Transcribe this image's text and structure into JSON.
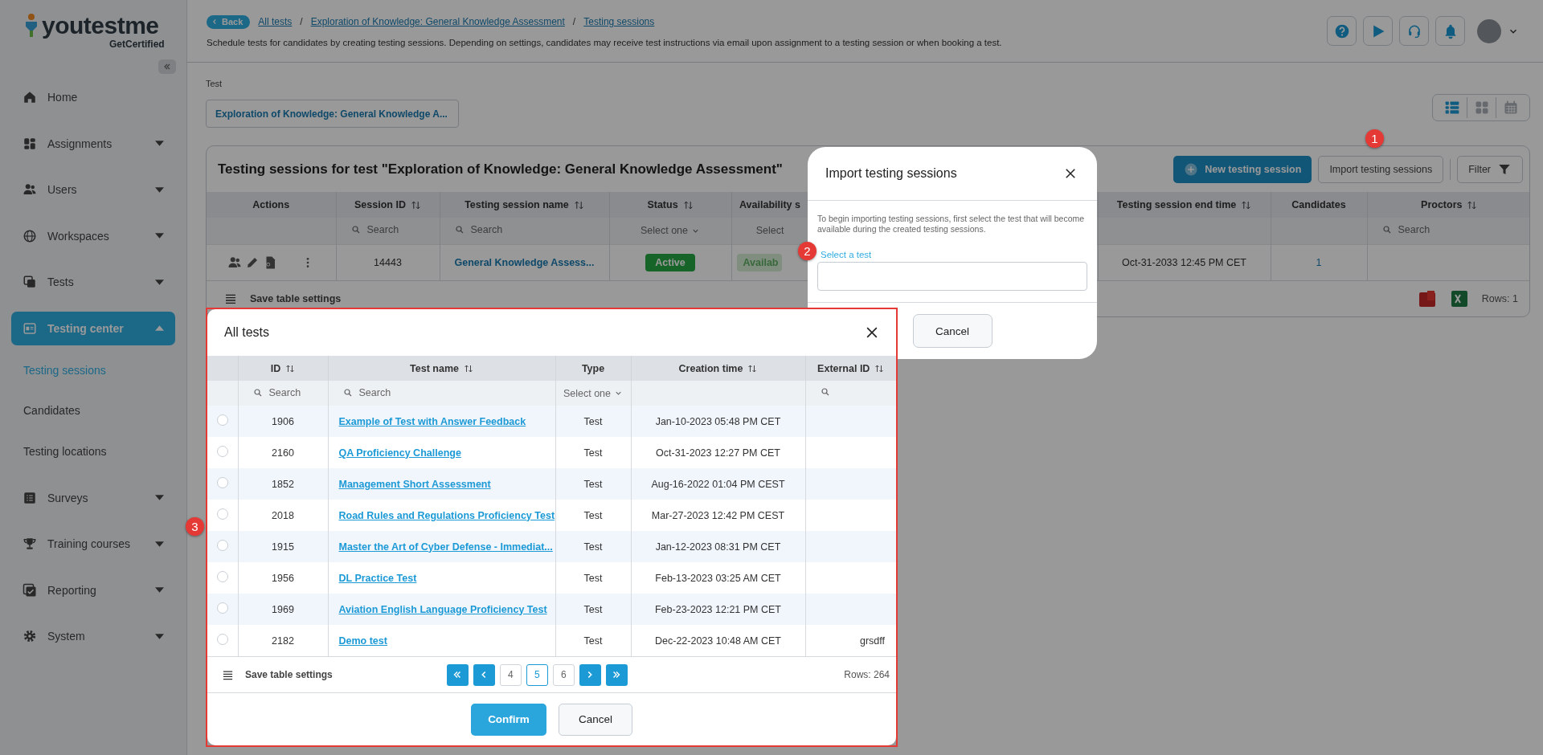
{
  "logo": {
    "wordmark": "youtestme",
    "tagline": "GetCertified"
  },
  "sidebar": {
    "items": [
      {
        "label": "Home",
        "kind": "link",
        "selected": false
      },
      {
        "label": "Assignments",
        "kind": "group",
        "expanded": false,
        "selected": false
      },
      {
        "label": "Users",
        "kind": "group",
        "expanded": false,
        "selected": false
      },
      {
        "label": "Workspaces",
        "kind": "group",
        "expanded": false,
        "selected": false
      },
      {
        "label": "Tests",
        "kind": "group",
        "expanded": false,
        "selected": false
      },
      {
        "label": "Testing center",
        "kind": "group",
        "expanded": true,
        "selected": true,
        "children": [
          {
            "label": "Testing sessions",
            "selected": true
          },
          {
            "label": "Candidates",
            "selected": false
          },
          {
            "label": "Testing locations",
            "selected": false
          }
        ]
      },
      {
        "label": "Surveys",
        "kind": "group",
        "expanded": false,
        "selected": false
      },
      {
        "label": "Training courses",
        "kind": "group",
        "expanded": false,
        "selected": false
      },
      {
        "label": "Reporting",
        "kind": "group",
        "expanded": false,
        "selected": false
      },
      {
        "label": "System",
        "kind": "group",
        "expanded": false,
        "selected": false
      }
    ]
  },
  "header": {
    "back": "Back",
    "breadcrumb": [
      "All tests",
      "Exploration of Knowledge: General Knowledge Assessment",
      "Testing sessions"
    ],
    "separator": "/",
    "description": "Schedule tests for candidates by creating testing sessions. Depending on settings, candidates may receive test instructions via email upon assignment to a testing session or when booking a test."
  },
  "test_field": {
    "label": "Test",
    "value": "Exploration of Knowledge: General Knowledge A..."
  },
  "view_modes": [
    {
      "kind": "list",
      "selected": true
    },
    {
      "kind": "grid",
      "selected": false
    },
    {
      "kind": "calendar",
      "selected": false
    }
  ],
  "sessions": {
    "title": "Testing sessions for test \"Exploration of Knowledge: General Knowledge Assessment\"",
    "new_button": "New testing session",
    "import_button": "Import testing sessions",
    "filter_button": "Filter",
    "columns": [
      {
        "label": "Actions",
        "sortable": false
      },
      {
        "label": "Session ID",
        "sortable": true,
        "filter": {
          "kind": "search",
          "placeholder": "Search"
        }
      },
      {
        "label": "Testing session name",
        "sortable": true,
        "filter": {
          "kind": "search",
          "placeholder": "Search"
        }
      },
      {
        "label": "Status",
        "sortable": true,
        "filter": {
          "kind": "select",
          "value": "Select one"
        }
      },
      {
        "label": "Availability s",
        "sortable": false,
        "filter": {
          "kind": "plain",
          "value": "Select"
        }
      },
      {
        "label": "Testing session end time",
        "sortable": true
      },
      {
        "label": "Candidates",
        "sortable": false
      },
      {
        "label": "Proctors",
        "sortable": true,
        "filter": {
          "kind": "search",
          "placeholder": "Search"
        }
      }
    ],
    "rows": [
      {
        "session_id": "14443",
        "name": "General Knowledge Assess...",
        "status": "Active",
        "availability": "Availab",
        "end_time": "Oct-31-2033 12:45 PM CET",
        "candidates": "1"
      }
    ],
    "save_settings": "Save table settings",
    "rows_count": "Rows: 1"
  },
  "import_dialog": {
    "title": "Import testing sessions",
    "description": "To begin importing testing sessions, first select the test that will become available during the created testing sessions.",
    "field_label": "Select a test",
    "cancel": "Cancel"
  },
  "all_tests": {
    "title": "All tests",
    "columns": [
      {
        "label": "ID",
        "sortable": true,
        "filter": {
          "kind": "search",
          "placeholder": "Search"
        }
      },
      {
        "label": "Test name",
        "sortable": true,
        "filter": {
          "kind": "search",
          "placeholder": "Search"
        }
      },
      {
        "label": "Type",
        "sortable": false,
        "filter": {
          "kind": "select",
          "value": "Select one"
        }
      },
      {
        "label": "Creation time",
        "sortable": true
      },
      {
        "label": "External ID",
        "sortable": true,
        "filter": {
          "kind": "search"
        }
      }
    ],
    "rows": [
      {
        "selected": false,
        "id": "1906",
        "name": "Example of Test with Answer Feedback",
        "type": "Test",
        "created": "Jan-10-2023 05:48 PM CET"
      },
      {
        "selected": false,
        "id": "2160",
        "name": "QA Proficiency Challenge",
        "type": "Test",
        "created": "Oct-31-2023 12:27 PM CET"
      },
      {
        "selected": false,
        "id": "1852",
        "name": "Management Short Assessment",
        "type": "Test",
        "created": "Aug-16-2022 01:04 PM CEST"
      },
      {
        "selected": false,
        "id": "2018",
        "name": "Road Rules and Regulations Proficiency Test",
        "type": "Test",
        "created": "Mar-27-2023 12:42 PM CEST"
      },
      {
        "selected": false,
        "id": "1915",
        "name": "Master the Art of Cyber Defense - Immediat...",
        "type": "Test",
        "created": "Jan-12-2023 08:31 PM CET"
      },
      {
        "selected": false,
        "id": "1956",
        "name": "DL Practice Test",
        "type": "Test",
        "created": "Feb-13-2023 03:25 AM CET"
      },
      {
        "selected": false,
        "id": "1969",
        "name": "Aviation English Language Proficiency Test",
        "type": "Test",
        "created": "Feb-23-2023 12:21 PM CET"
      },
      {
        "selected": false,
        "id": "2182",
        "name": "Demo test",
        "type": "Test",
        "created": "Dec-22-2023 10:48 AM CET",
        "external_id": "grsdff"
      }
    ],
    "save_settings": "Save table settings",
    "pages": [
      {
        "label": "4",
        "selected": false
      },
      {
        "label": "5",
        "selected": true
      },
      {
        "label": "6",
        "selected": false
      }
    ],
    "rows_count": "Rows: 264",
    "confirm": "Confirm",
    "cancel": "Cancel"
  },
  "annotations": [
    {
      "label": "1"
    },
    {
      "label": "2"
    },
    {
      "label": "3"
    }
  ]
}
